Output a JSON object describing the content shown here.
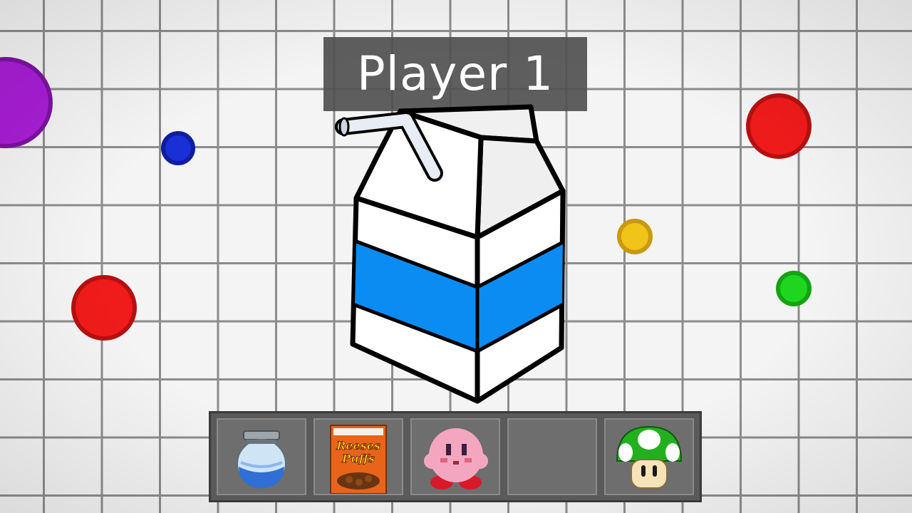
{
  "player": {
    "name": "Player 1"
  },
  "pellets": [
    {
      "id": "purple-blob",
      "color": "#a81ed6",
      "border": "#7d12a3"
    },
    {
      "id": "blue-dot",
      "color": "#1a2fd6",
      "border": "#0f1e9e"
    },
    {
      "id": "red-dot-right",
      "color": "#f01b1b",
      "border": "#b51010"
    },
    {
      "id": "red-dot-left",
      "color": "#f01b1b",
      "border": "#b51010"
    },
    {
      "id": "yellow-dot",
      "color": "#f0c419",
      "border": "#c99a0c"
    },
    {
      "id": "green-dot",
      "color": "#1ed61e",
      "border": "#12a312"
    }
  ],
  "carton": {
    "band_color": "#0a8cf2"
  },
  "hotbar": {
    "slots": [
      {
        "item": "slurp-jar-icon"
      },
      {
        "item": "cereal-box-icon",
        "box_text": [
          "Reeses",
          "Puffs"
        ]
      },
      {
        "item": "kirby-icon"
      },
      {
        "item": "empty-slot"
      },
      {
        "item": "mushroom-1up-icon"
      }
    ]
  }
}
